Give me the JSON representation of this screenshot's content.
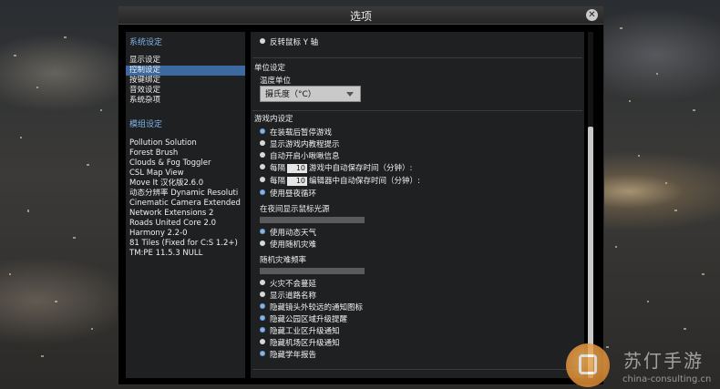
{
  "window": {
    "title": "选项"
  },
  "sidebar": {
    "system_header": "系统设定",
    "system_items": [
      {
        "label": "显示设定",
        "selected": false
      },
      {
        "label": "控制设定",
        "selected": true
      },
      {
        "label": "按键绑定",
        "selected": false
      },
      {
        "label": "音效设定",
        "selected": false
      },
      {
        "label": "系统杂项",
        "selected": false
      }
    ],
    "mods_header": "模组设定",
    "mod_items": [
      "Pollution Solution",
      "Forest Brush",
      "Clouds & Fog Toggler",
      "CSL Map View",
      "Move It 汉化版2.6.0",
      "动态分辨率 Dynamic Resoluti",
      "Cinematic Camera Extended",
      "Network Extensions 2",
      "Roads United Core 2.0",
      "Harmony 2.2-0",
      "81 Tiles (Fixed for C:S 1.2+)",
      "TM:PE 11.5.3 NULL"
    ]
  },
  "content": {
    "invert_mouse_y": {
      "label": "反转鼠标 Y 轴",
      "checked": false
    },
    "units": {
      "title": "单位设定",
      "temp_label": "温度单位",
      "temp_value": "摄氏度（°C）"
    },
    "ingame": {
      "title": "游戏内设定",
      "pause_on_load": {
        "label": "在装载后暂停游戏",
        "checked": true
      },
      "show_tutorial": {
        "label": "显示游戏内教程提示",
        "checked": false
      },
      "chirper": {
        "label": "自动开启小啾啾信息",
        "checked": false
      },
      "autosave_game": {
        "prefix": "每隔",
        "value": "10",
        "suffix": "游戏中自动保存时间（分钟）:",
        "checked": false
      },
      "autosave_editor": {
        "prefix": "每隔",
        "value": "10",
        "suffix": "编辑器中自动保存时间（分钟）:",
        "checked": false
      },
      "day_night": {
        "label": "使用昼夜循环",
        "checked": true
      },
      "night_cursor_light": "在夜间显示鼠标光源",
      "dynamic_weather": {
        "label": "使用动态天气",
        "checked": true
      },
      "random_disasters": {
        "label": "使用随机灾难",
        "checked": false
      },
      "disaster_frequency": "随机灾难频率",
      "fire_no_spread": {
        "label": "火灾不会蔓延",
        "checked": false
      },
      "show_road_names": {
        "label": "显示道路名称",
        "checked": false
      },
      "hide_far_notifications": {
        "label": "隐藏镜头外较远的通知图标",
        "checked": true
      },
      "hide_park_upgrade": {
        "label": "隐藏公园区域升级提醒",
        "checked": true
      },
      "hide_industry_upgrade": {
        "label": "隐藏工业区升级通知",
        "checked": true
      },
      "hide_airport_upgrade": {
        "label": "隐藏机场区升级通知",
        "checked": false
      },
      "hide_school_report": {
        "label": "隐藏学年报告",
        "checked": true
      }
    }
  },
  "watermark": {
    "text": "苏仃手游",
    "url": "china-consulting.cn"
  },
  "colors": {
    "accent": "#3c6aa0",
    "header_blue": "#7fb3e6",
    "panel": "#1f2022",
    "dialog": "#000000"
  }
}
